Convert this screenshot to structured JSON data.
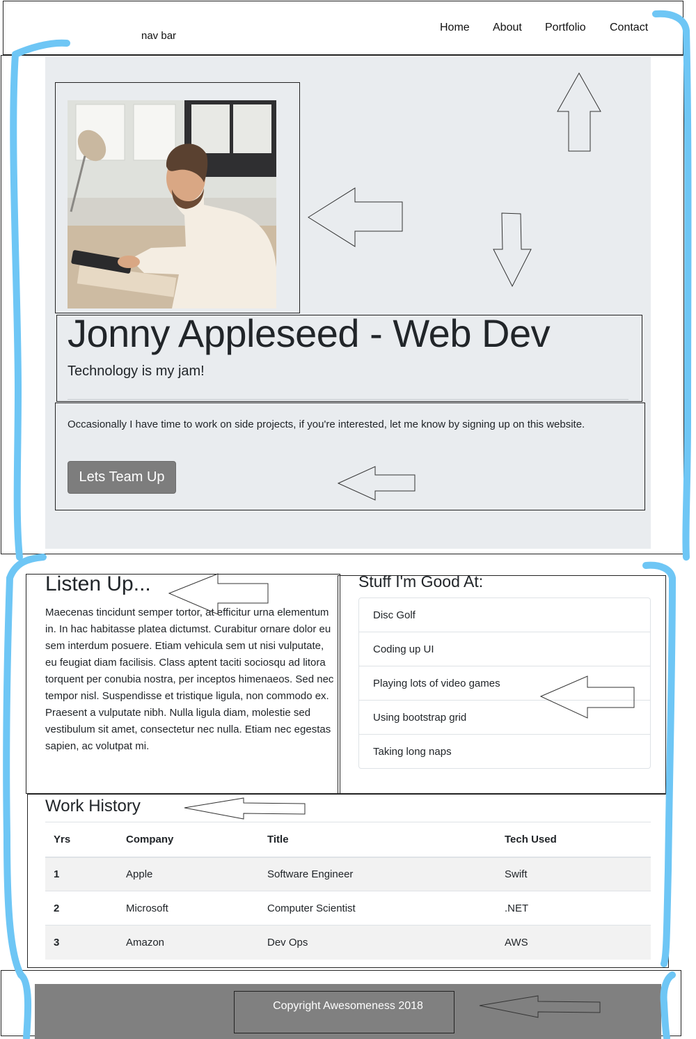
{
  "navbar": {
    "label": "nav bar",
    "links": [
      "Home",
      "About",
      "Portfolio",
      "Contact"
    ]
  },
  "hero": {
    "title": "Jonny Appleseed - Web Dev",
    "subtitle": "Technology is my jam!",
    "text": "Occasionally I have time to work on side projects, if you're interested, let me know by signing up on this website.",
    "button_label": "Lets Team Up"
  },
  "listen": {
    "heading": "Listen Up...",
    "text": "Maecenas tincidunt semper tortor, at efficitur urna elementum in. In hac habitasse platea dictumst. Curabitur ornare dolor eu sem interdum posuere. Etiam vehicula sem ut nisi vulputate, eu feugiat diam facilisis. Class aptent taciti sociosqu ad litora torquent per conubia nostra, per inceptos himenaeos. Sed nec tempor nisl. Suspendisse et tristique ligula, non commodo ex. Praesent a vulputate nibh. Nulla ligula diam, molestie sed vestibulum sit amet, consectetur nec nulla. Etiam nec egestas sapien, ac volutpat mi."
  },
  "skills": {
    "heading": "Stuff I'm Good At:",
    "items": [
      "Disc Golf",
      "Coding up UI",
      "Playing lots of video games",
      "Using bootstrap grid",
      "Taking long naps"
    ]
  },
  "work": {
    "heading": "Work History",
    "columns": [
      "Yrs",
      "Company",
      "Title",
      "Tech Used"
    ],
    "rows": [
      [
        "1",
        "Apple",
        "Software Engineer",
        "Swift"
      ],
      [
        "2",
        "Microsoft",
        "Computer Scientist",
        ".NET"
      ],
      [
        "3",
        "Amazon",
        "Dev Ops",
        "AWS"
      ]
    ]
  },
  "footer": {
    "text": "Copyright Awesomeness 2018"
  },
  "colors": {
    "jumbotron_bg": "#e9ecef",
    "button_bg": "#7d7d7d",
    "footer_bg": "#808080",
    "annotation_blue": "#6ec6f5"
  },
  "icons": [
    "arrow-left-annotation",
    "arrow-up-annotation",
    "arrow-down-annotation"
  ]
}
